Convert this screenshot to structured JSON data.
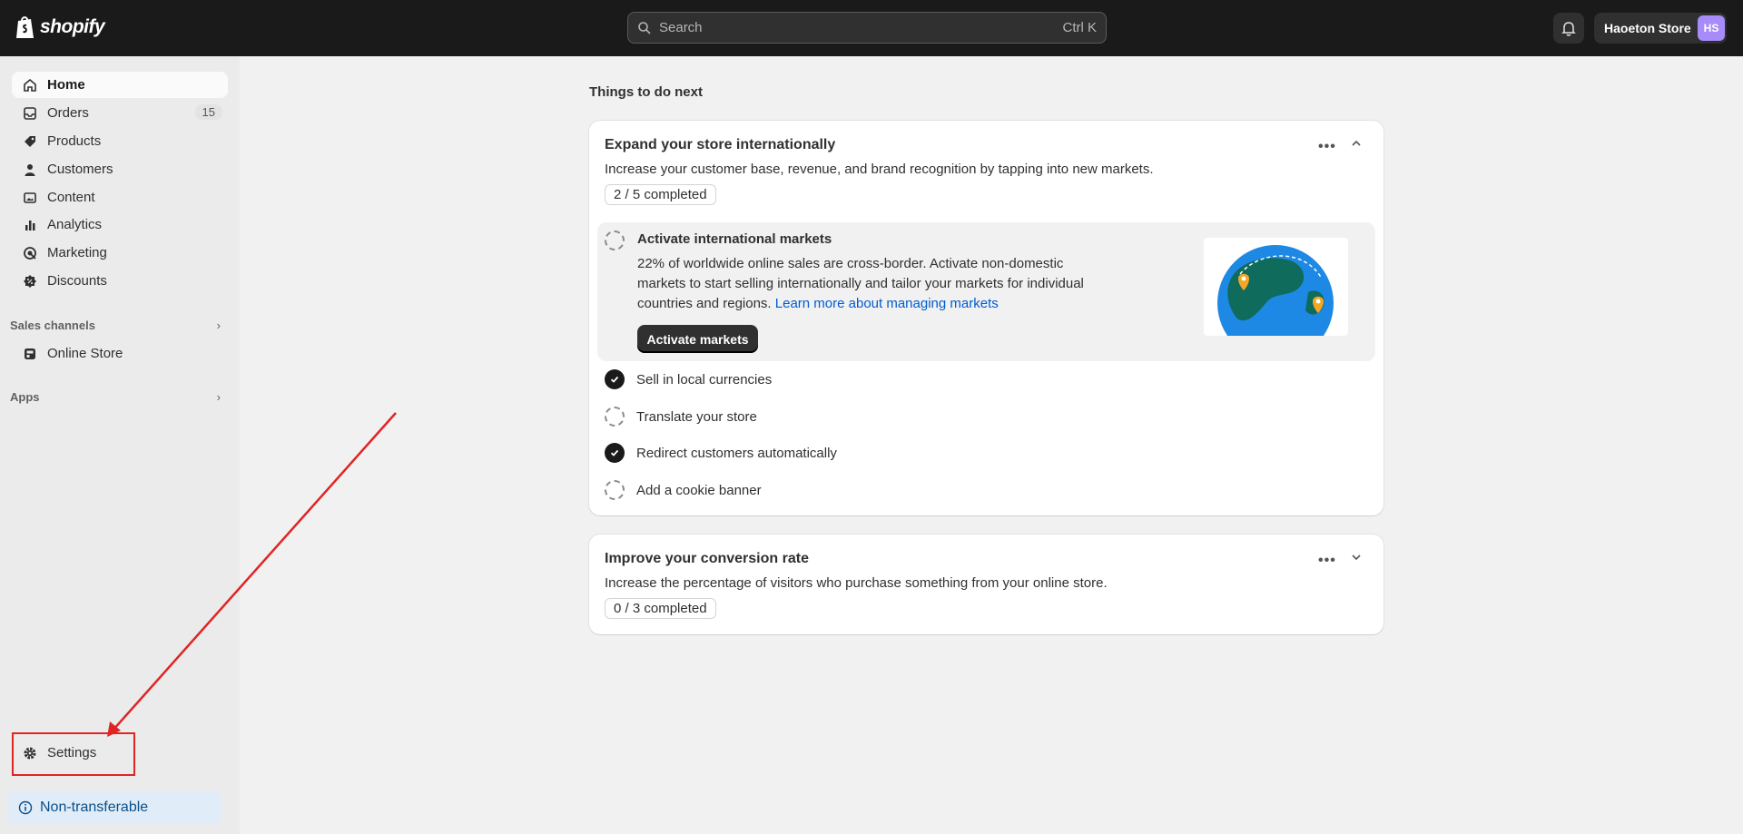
{
  "topbar": {
    "logo_text": "shopify",
    "search_placeholder": "Search",
    "search_shortcut": "Ctrl K",
    "store_name": "Haoeton Store",
    "avatar_initials": "HS"
  },
  "sidebar": {
    "items": [
      {
        "label": "Home",
        "icon": "home-icon",
        "active": true
      },
      {
        "label": "Orders",
        "icon": "orders-icon",
        "count": "15"
      },
      {
        "label": "Products",
        "icon": "tag-icon"
      },
      {
        "label": "Customers",
        "icon": "person-icon"
      },
      {
        "label": "Content",
        "icon": "image-icon"
      },
      {
        "label": "Analytics",
        "icon": "bar-chart-icon"
      },
      {
        "label": "Marketing",
        "icon": "target-icon"
      },
      {
        "label": "Discounts",
        "icon": "discount-icon"
      }
    ],
    "sales_channels_label": "Sales channels",
    "online_store_label": "Online Store",
    "apps_label": "Apps",
    "settings_label": "Settings",
    "nontransferable_label": "Non-transferable"
  },
  "main": {
    "heading": "Things to do next",
    "card1": {
      "title": "Expand your store internationally",
      "description": "Increase your customer base, revenue, and brand recognition by tapping into new markets.",
      "progress": "2 / 5 completed",
      "expanded_task": {
        "title": "Activate international markets",
        "body": "22% of worldwide online sales are cross-border. Activate non-domestic markets to start selling internationally and tailor your markets for individual countries and regions.",
        "link": "Learn more about managing markets",
        "button": "Activate markets"
      },
      "tasks": [
        {
          "label": "Sell in local currencies",
          "done": true
        },
        {
          "label": "Translate your store",
          "done": false
        },
        {
          "label": "Redirect customers automatically",
          "done": true
        },
        {
          "label": "Add a cookie banner",
          "done": false
        }
      ]
    },
    "card2": {
      "title": "Improve your conversion rate",
      "description": "Increase the percentage of visitors who purchase something from your online store.",
      "progress": "0 / 3 completed"
    }
  },
  "colors": {
    "topbar_bg": "#1a1a1a",
    "sidebar_bg": "#ebebeb",
    "page_bg": "#f1f1f1",
    "link": "#005bd3",
    "annotation_red": "#e02424",
    "avatar": "#a78bfa"
  }
}
